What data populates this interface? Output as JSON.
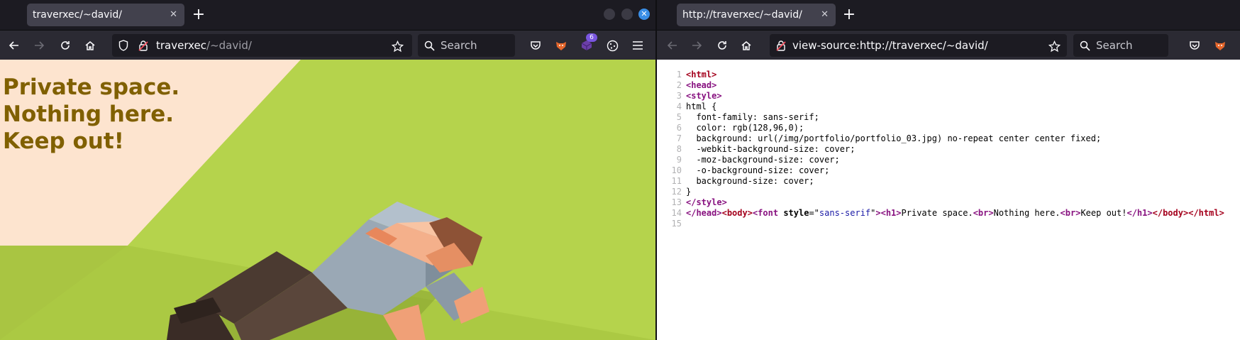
{
  "left_window": {
    "tab_title": "traverxec/~david/",
    "url_host": "traverxec",
    "url_path": "/~david/",
    "search_placeholder": "Search",
    "extension_badge": "6",
    "page_heading_lines": [
      "Private space.",
      "Nothing here.",
      "Keep out!"
    ],
    "colors": {
      "heading": "#806000",
      "grass": "#b3d24a",
      "wall": "#fde4cf"
    }
  },
  "right_window": {
    "tab_title": "http://traverxec/~david/",
    "url": "view-source:http://traverxec/~david/",
    "search_placeholder": "Search",
    "source_lines": [
      {
        "n": "1",
        "text": "<html>"
      },
      {
        "n": "2",
        "text": "<head>"
      },
      {
        "n": "3",
        "text": "<style>"
      },
      {
        "n": "4",
        "text": "html {"
      },
      {
        "n": "5",
        "text": "  font-family: sans-serif;"
      },
      {
        "n": "6",
        "text": "  color: rgb(128,96,0);"
      },
      {
        "n": "7",
        "text": "  background: url(/img/portfolio/portfolio_03.jpg) no-repeat center center fixed;"
      },
      {
        "n": "8",
        "text": "  -webkit-background-size: cover;"
      },
      {
        "n": "9",
        "text": "  -moz-background-size: cover;"
      },
      {
        "n": "10",
        "text": "  -o-background-size: cover;"
      },
      {
        "n": "11",
        "text": "  background-size: cover;"
      },
      {
        "n": "12",
        "text": "}"
      },
      {
        "n": "13",
        "text": "</style>"
      },
      {
        "n": "14",
        "text": "</head><body><font style=\"sans-serif\"><h1>Private space.<br>Nothing here.<br>Keep out!</h1></body></html>"
      },
      {
        "n": "15",
        "text": ""
      }
    ]
  }
}
